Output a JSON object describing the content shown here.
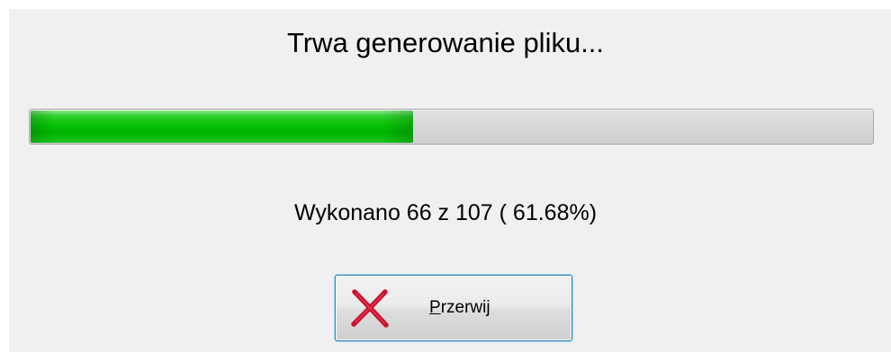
{
  "dialog": {
    "title": "Trwa generowanie pliku...",
    "progress": {
      "fill_fraction": 0.455,
      "fill_color": "#00bf00",
      "track_color": "#d6d6d6"
    },
    "status_text": "Wykonano 66 z 107 ( 61.68%)",
    "abort_button": {
      "icon": "red-x-icon",
      "label": {
        "accel": "P",
        "rest": "rzerwij"
      }
    }
  }
}
